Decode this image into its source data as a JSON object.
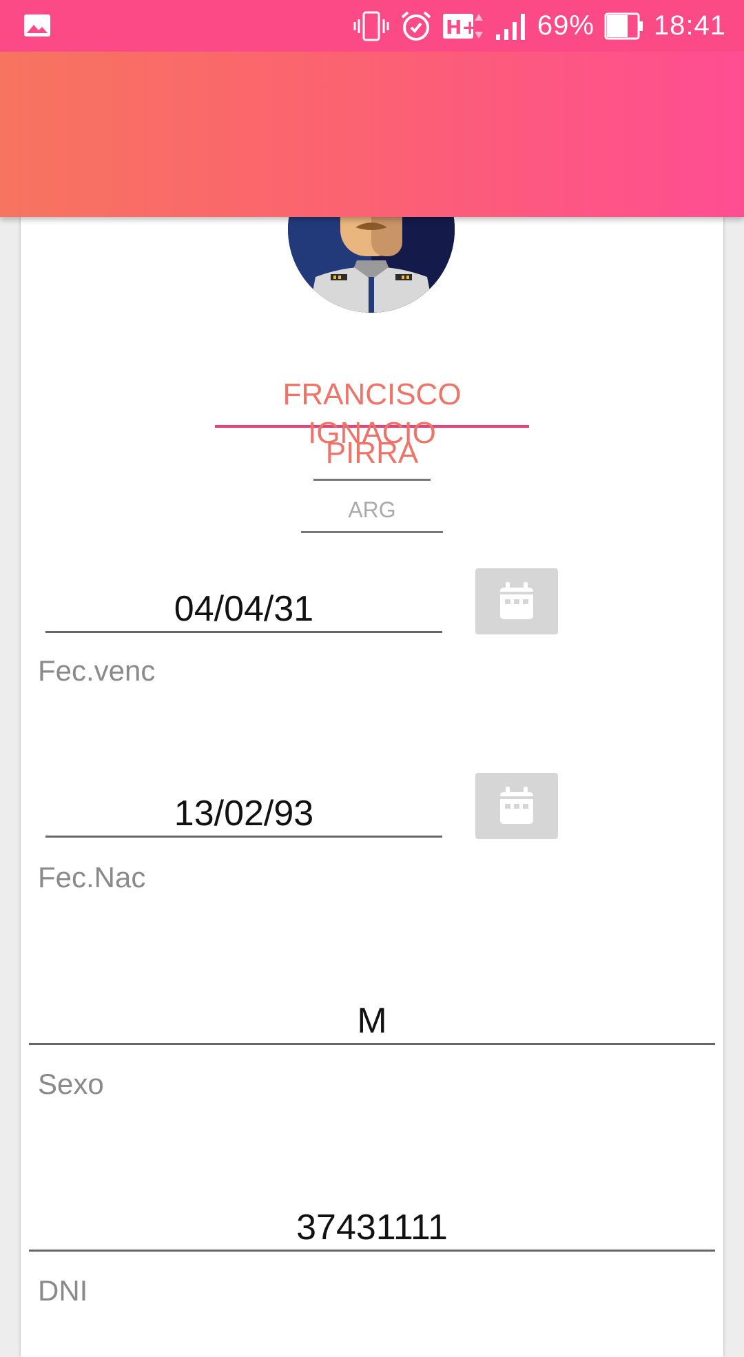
{
  "status_bar": {
    "battery_percent": "69%",
    "time": "18:41",
    "icons": [
      "gallery-icon",
      "vibrate-icon",
      "alarm-icon",
      "hplus-icon",
      "signal-icon",
      "battery-icon"
    ]
  },
  "toolbar": {
    "gradient": [
      "#f7745f",
      "#fb6370",
      "#ff4d92"
    ]
  },
  "profile": {
    "first_name": "FRANCISCO IGNACIO",
    "last_name": "PIRRA",
    "country": "ARG"
  },
  "fields": {
    "expiry_date": {
      "value": "04/04/31",
      "label": "Fec.venc"
    },
    "birth_date": {
      "value": "13/02/93",
      "label": "Fec.Nac"
    },
    "sex": {
      "value": "M",
      "label": "Sexo"
    },
    "dni": {
      "value": "37431111",
      "label": "DNI"
    }
  },
  "colors": {
    "accent": "#fb4a85",
    "name_text": "#ec7469"
  }
}
